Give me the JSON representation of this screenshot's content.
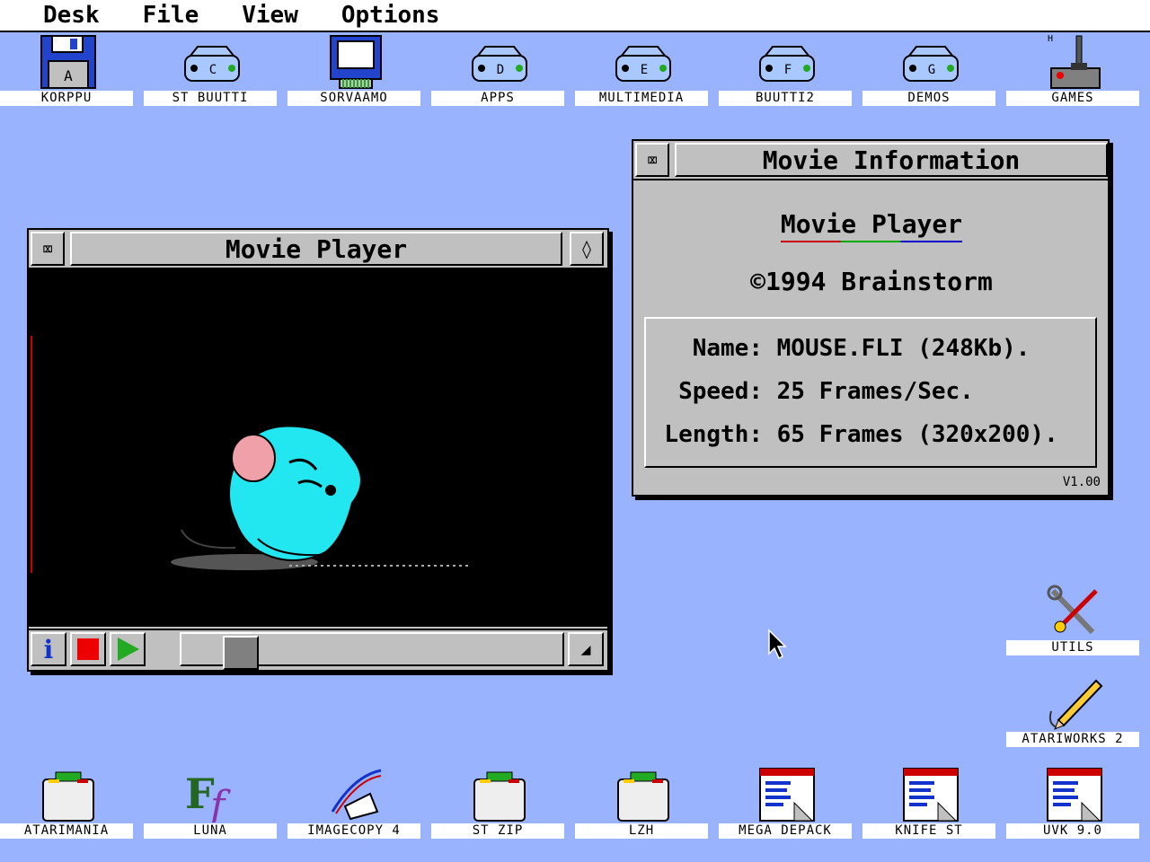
{
  "menu": [
    "Desk",
    "File",
    "View",
    "Options"
  ],
  "top_icons": [
    {
      "label": "KORPPU",
      "kind": "floppy",
      "letter": "A"
    },
    {
      "label": "ST BUUTTI",
      "kind": "drive",
      "letter": "C"
    },
    {
      "label": "SORVAAMO",
      "kind": "cartridge",
      "letter": ""
    },
    {
      "label": "APPS",
      "kind": "drive",
      "letter": "D"
    },
    {
      "label": "MULTIMEDIA",
      "kind": "drive",
      "letter": "E"
    },
    {
      "label": "BUUTTI2",
      "kind": "drive",
      "letter": "F"
    },
    {
      "label": "DEMOS",
      "kind": "drive",
      "letter": "G"
    },
    {
      "label": "GAMES",
      "kind": "joystick",
      "letter": "H"
    }
  ],
  "right_icons": [
    {
      "label": "UTILS",
      "kind": "tools"
    },
    {
      "label": "ATARIWORKS 2",
      "kind": "pencil"
    }
  ],
  "bottom_icons": [
    {
      "label": "ATARIMANIA",
      "kind": "box"
    },
    {
      "label": "LUNA",
      "kind": "font"
    },
    {
      "label": "IMAGECOPY 4",
      "kind": "pen"
    },
    {
      "label": "ST ZIP",
      "kind": "box"
    },
    {
      "label": "LZH",
      "kind": "box"
    },
    {
      "label": "MEGA DEPACK",
      "kind": "doc"
    },
    {
      "label": "KNIFE ST",
      "kind": "doc"
    },
    {
      "label": "UVK 9.0",
      "kind": "doc"
    }
  ],
  "player": {
    "title": "Movie Player",
    "closer_glyph": "⌧",
    "fuller_glyph": "◊",
    "info_glyph": "i",
    "size_glyph": "◢",
    "position": 0.12
  },
  "info_window": {
    "title": "Movie Information",
    "closer_glyph": "⌧",
    "app": "Movie Player",
    "copyright": "©1994 Brainstorm",
    "name_key": "Name:",
    "name_val": "MOUSE.FLI (248Kb).",
    "speed_key": "Speed:",
    "speed_val": "25 Frames/Sec.",
    "length_key": "Length:",
    "length_val": "65 Frames (320x200).",
    "version": "V1.00"
  },
  "colors": {
    "desktop": "#99b3ff",
    "window": "#c0c0c0",
    "mouse": "#22e6f0",
    "ear": "#f0a0a8"
  }
}
